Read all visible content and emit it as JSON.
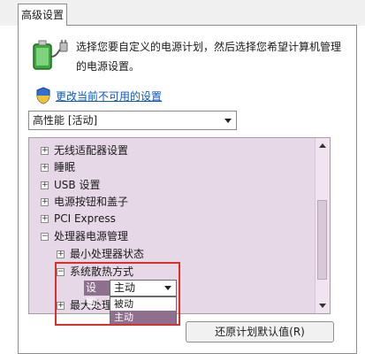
{
  "tab": {
    "label": "高级设置"
  },
  "description": {
    "line1": "选择您要自定义的电源计划，然后选择您希望计算机管理",
    "line2": "的电源设置。"
  },
  "link_text": "更改当前不可用的设置",
  "plan_select": {
    "value": "高性能 [活动]"
  },
  "tree": {
    "items": [
      {
        "label": "无线适配器设置",
        "expander": "+"
      },
      {
        "label": "睡眠",
        "expander": "+"
      },
      {
        "label": "USB 设置",
        "expander": "+"
      },
      {
        "label": "电源按钮和盖子",
        "expander": "+"
      },
      {
        "label": "PCI Express",
        "expander": "+"
      },
      {
        "label": "处理器电源管理",
        "expander": "−"
      }
    ],
    "sub_items": [
      {
        "label": "最小处理器状态",
        "expander": "+"
      },
      {
        "label": "系统散热方式",
        "expander": "−"
      },
      {
        "label": "最大处理",
        "expander": "+"
      }
    ]
  },
  "setting": {
    "label": "设置:",
    "value": "主动",
    "options": [
      "被动",
      "主动"
    ],
    "selected_option": "主动"
  },
  "restore_button": "还原计划默认值(R)",
  "colors": {
    "selection": "#8e6f8e",
    "tree_bg": "#e6d8e6",
    "highlight_box": "#d9302b",
    "link": "#0a57c8"
  },
  "icons": [
    "battery-power-icon",
    "uac-shield-icon"
  ]
}
